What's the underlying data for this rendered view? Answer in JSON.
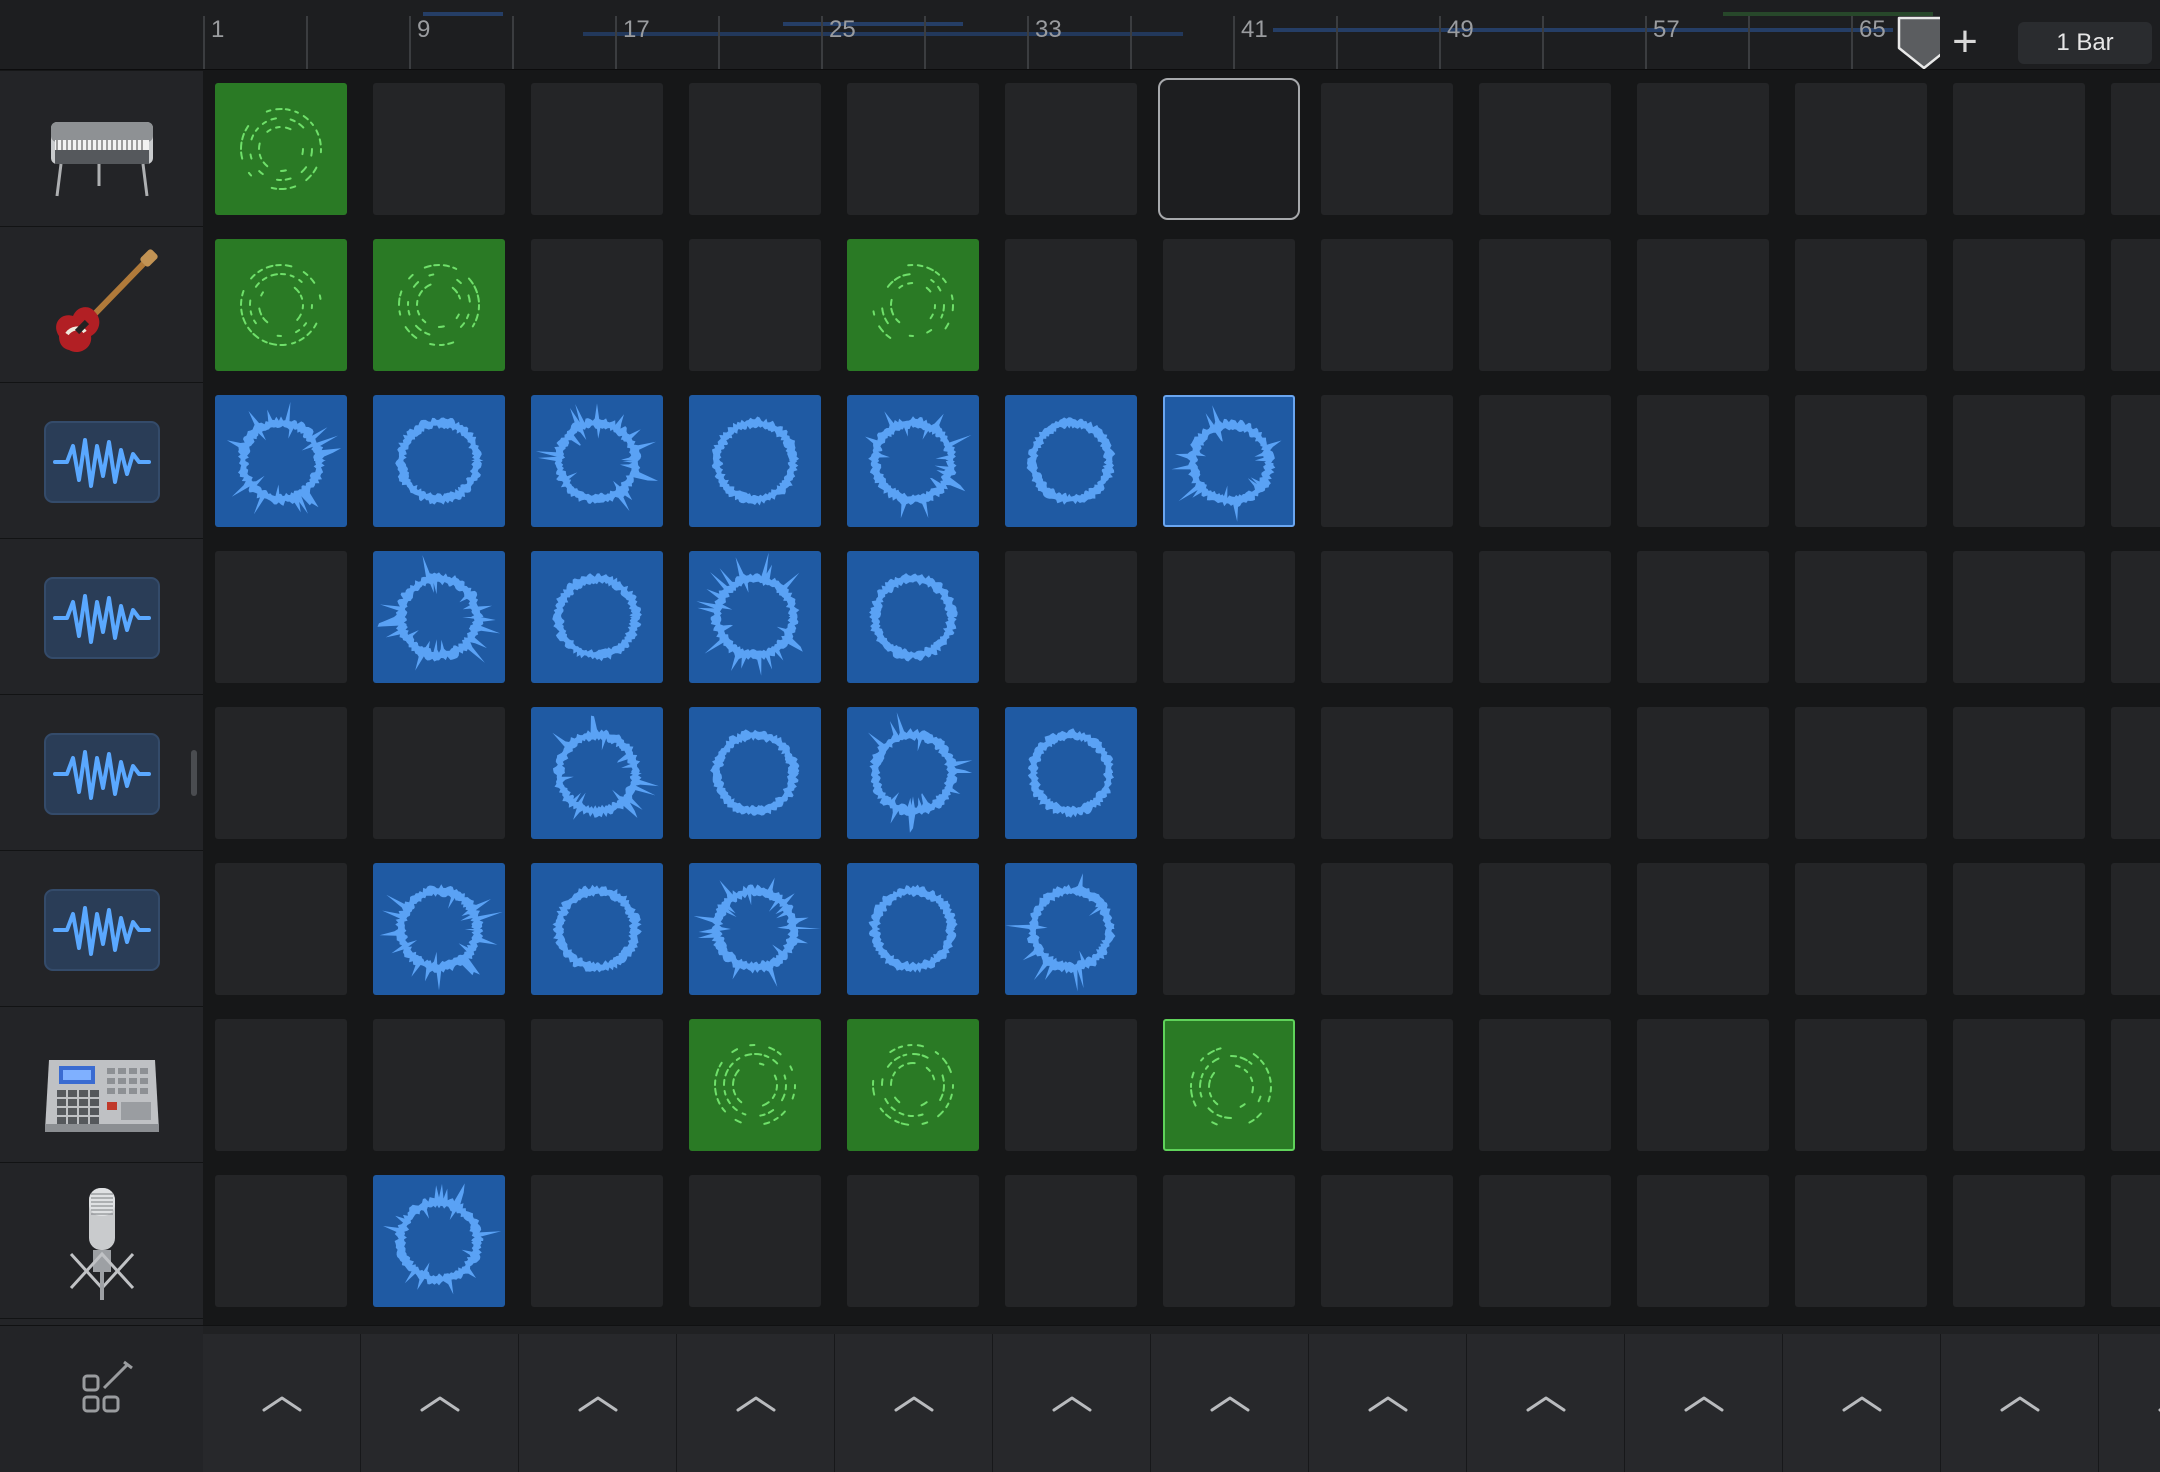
{
  "ruler": {
    "bar_numbers": [
      "1",
      "9",
      "17",
      "25",
      "33",
      "41",
      "49",
      "57",
      "65"
    ],
    "add_label": "+",
    "snap_value": "1 Bar"
  },
  "colors": {
    "blue_cell": "#1f5aa3",
    "blue_wave": "#5aa2f5",
    "green_cell": "#2a7a25",
    "green_wave": "#6fe06a",
    "empty_cell": "#242527"
  },
  "tracks": [
    {
      "name": "electric-piano",
      "icon": "electric-piano-icon"
    },
    {
      "name": "bass-guitar",
      "icon": "bass-guitar-icon"
    },
    {
      "name": "audio-track-1",
      "icon": "waveform-icon"
    },
    {
      "name": "audio-track-2",
      "icon": "waveform-icon"
    },
    {
      "name": "audio-track-3",
      "icon": "waveform-icon"
    },
    {
      "name": "audio-track-4",
      "icon": "waveform-icon"
    },
    {
      "name": "drum-machine",
      "icon": "drum-machine-icon"
    },
    {
      "name": "microphone",
      "icon": "microphone-icon"
    }
  ],
  "grid": [
    "G.....S.....",
    "GG..G.......",
    "BBBBBBb.....",
    ".BBBB.......",
    "..BBBB......",
    ".BBBBB......",
    "...GG.G.....",
    ".B.........."
  ],
  "bottom": {
    "edit_icon": "edit-cells-icon",
    "column_triggers": 12,
    "trigger_icon": "chevron-up-icon"
  }
}
